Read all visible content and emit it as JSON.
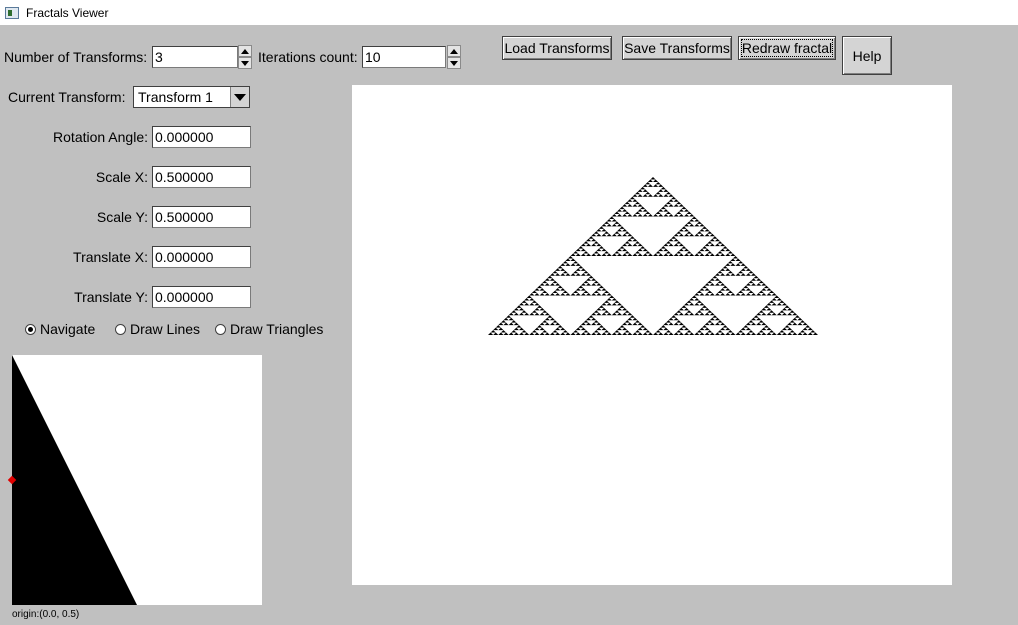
{
  "window": {
    "title": "Fractals Viewer"
  },
  "controls": {
    "num_transforms_label": "Number of Transforms:",
    "num_transforms_value": "3",
    "iterations_label": "Iterations count:",
    "iterations_value": "10",
    "current_transform_label": "Current Transform:",
    "current_transform_value": "Transform 1"
  },
  "params": {
    "rotation_label": "Rotation Angle:",
    "rotation_value": "0.000000",
    "scale_x_label": "Scale X:",
    "scale_x_value": "0.500000",
    "scale_y_label": "Scale Y:",
    "scale_y_value": "0.500000",
    "translate_x_label": "Translate X:",
    "translate_x_value": "0.000000",
    "translate_y_label": "Translate Y:",
    "translate_y_value": "0.000000"
  },
  "modes": {
    "navigate": "Navigate",
    "draw_lines": "Draw Lines",
    "draw_triangles": "Draw Triangles",
    "selected": "Navigate"
  },
  "buttons": {
    "load": "Load Transforms",
    "save": "Save Transforms",
    "redraw": "Redraw fractal",
    "help": "Help"
  },
  "preview": {
    "origin_text": "origin:(0.0, 0.5)"
  },
  "fractal": {
    "type": "sierpinski",
    "depth": 6,
    "color": "#000000"
  },
  "colors": {
    "background": "#c0c0c0",
    "canvas": "#ffffff",
    "origin_marker": "#e00000"
  }
}
